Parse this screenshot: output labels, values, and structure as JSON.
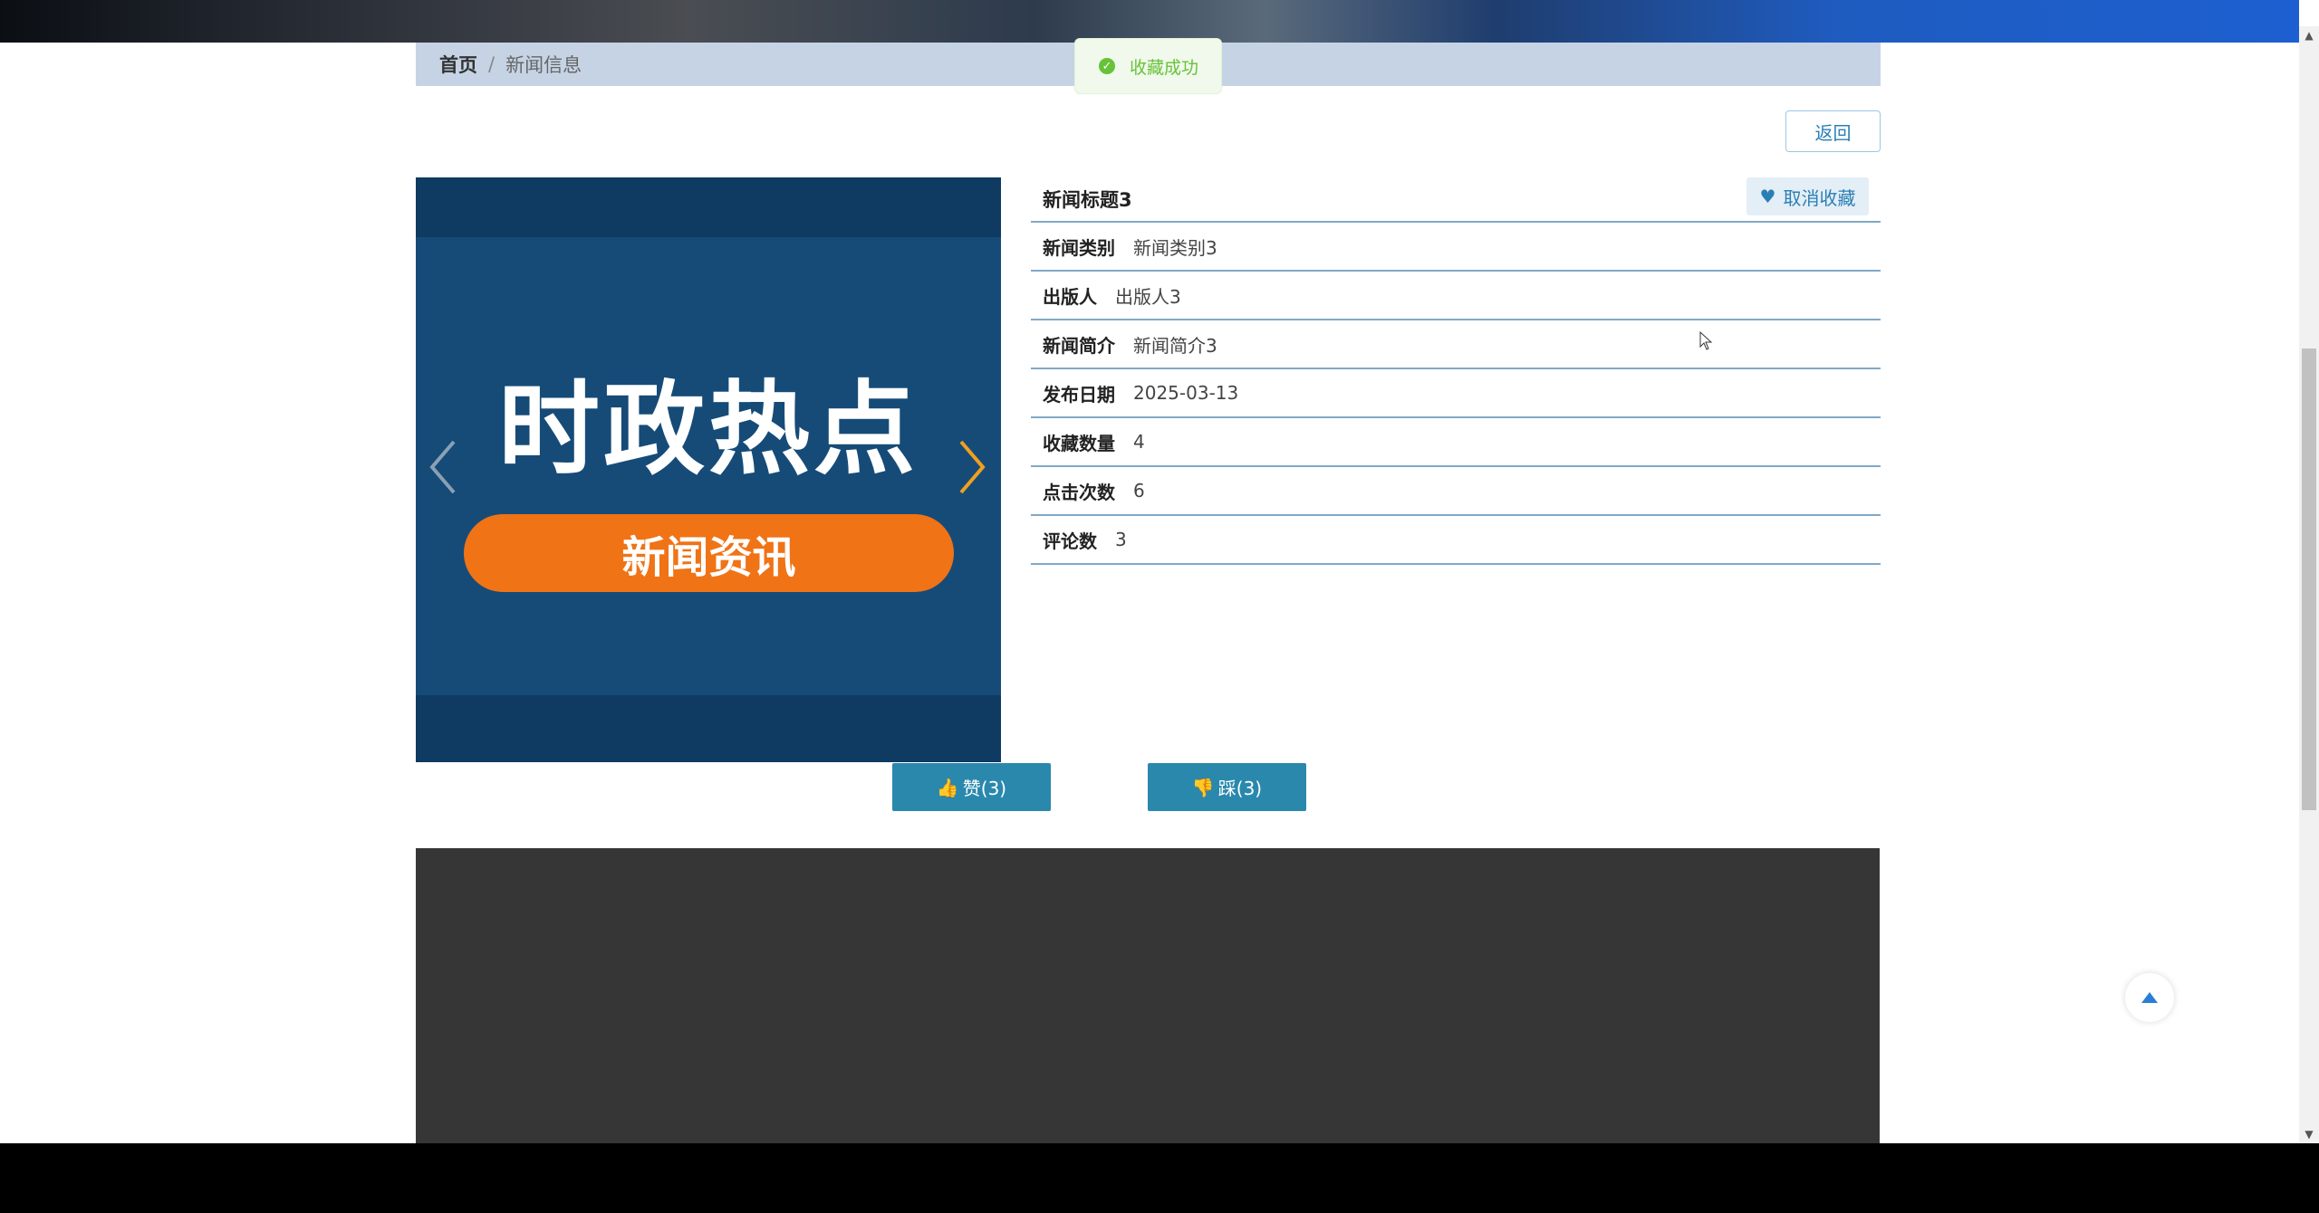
{
  "breadcrumb": {
    "home": "首页",
    "separator": "/",
    "current": "新闻信息"
  },
  "toast": {
    "message": "收藏成功",
    "icon": "check-circle-icon",
    "color": "#67c23a"
  },
  "back_label": "返回",
  "carousel": {
    "heading": "时政热点",
    "pill_text": "新闻资讯",
    "pill_color": "#f07316",
    "bg_color": "#164b78"
  },
  "news": {
    "title": "新闻标题3",
    "favorite_label": "取消收藏",
    "fields": [
      {
        "key": "新闻类别",
        "value": "新闻类别3"
      },
      {
        "key": "出版人",
        "value": "出版人3"
      },
      {
        "key": "新闻简介",
        "value": "新闻简介3"
      },
      {
        "key": "发布日期",
        "value": "2025-03-13"
      },
      {
        "key": "收藏数量",
        "value": "4"
      },
      {
        "key": "点击次数",
        "value": "6"
      },
      {
        "key": "评论数",
        "value": "3"
      }
    ]
  },
  "votes": {
    "like_label": "赞(3)",
    "dislike_label": "踩(3)",
    "button_color": "#2a88ad"
  }
}
